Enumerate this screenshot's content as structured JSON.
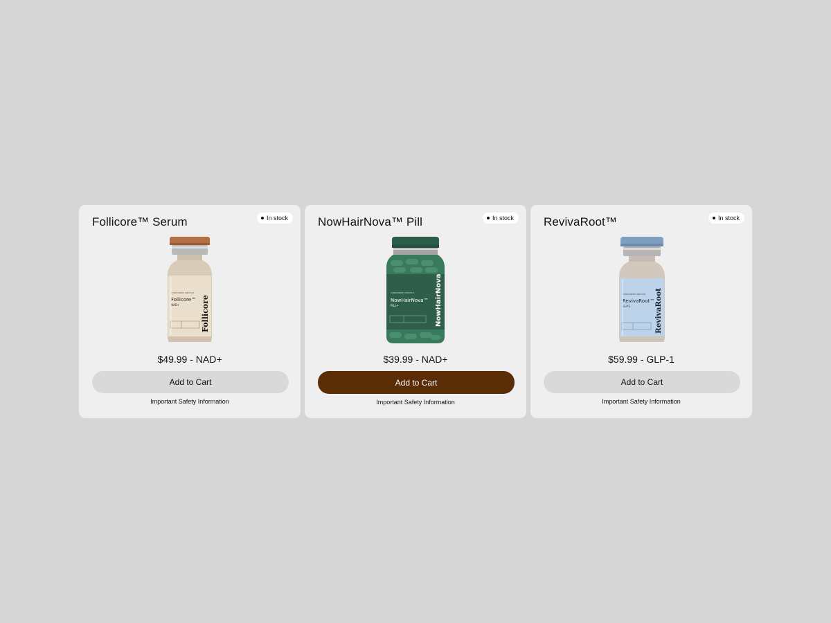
{
  "products": [
    {
      "title": "Follicore™ Serum",
      "stock": "In stock",
      "price": "$49.99 - NAD+",
      "cart_label": "Add to Cart",
      "safety_label": "Important Safety Information",
      "label": {
        "top": "COMPOUNDED INJECTION",
        "name": "Follicore™",
        "sub": "NAD+",
        "side": "Follicore"
      },
      "colors": {
        "cap": "#b36e42",
        "label": "#eadfcd"
      },
      "icon": "vial-image"
    },
    {
      "title": "NowHairNova™ Pill",
      "stock": "In stock",
      "price": "$39.99 - NAD+",
      "cart_label": "Add to Cart",
      "safety_label": "Important Safety Information",
      "label": {
        "top": "COMPOUNDED IN BOTTLE",
        "name": "NowHairNova™",
        "sub": "PILL+",
        "side": "NowHairNova"
      },
      "colors": {
        "cap": "#2b5d48",
        "label": "#2f5f4a",
        "button": "#5a2d06"
      },
      "icon": "pill-bottle-image"
    },
    {
      "title": "RevivaRoot™",
      "stock": "In stock",
      "price": "$59.99 - GLP-1",
      "cart_label": "Add to Cart",
      "safety_label": "Important Safety Information",
      "label": {
        "top": "COMPOUNDED INJECTION",
        "name": "RevivaRoot™",
        "sub": "GLP-1",
        "side": "RevivaRoot"
      },
      "colors": {
        "cap": "#7f9ec0",
        "label": "#bcd3ea"
      },
      "icon": "vial-image"
    }
  ]
}
